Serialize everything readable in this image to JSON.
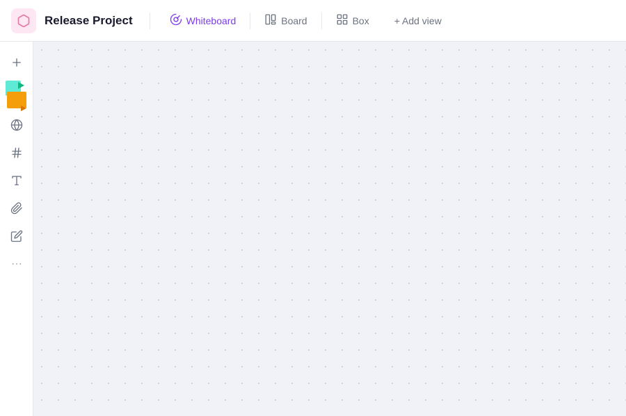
{
  "header": {
    "project_icon_alt": "release-project-icon",
    "project_title": "Release Project",
    "tabs": [
      {
        "id": "whiteboard",
        "label": "Whiteboard",
        "active": true,
        "icon": "whiteboard"
      },
      {
        "id": "board",
        "label": "Board",
        "active": false,
        "icon": "board"
      },
      {
        "id": "box",
        "label": "Box",
        "active": false,
        "icon": "box"
      }
    ],
    "add_view_label": "+ Add view"
  },
  "sidebar": {
    "tools": [
      {
        "id": "add",
        "icon": "plus",
        "label": "Add"
      },
      {
        "id": "sticky",
        "icon": "sticky-notes",
        "label": "Sticky Notes"
      },
      {
        "id": "globe",
        "icon": "globe",
        "label": "Globe"
      },
      {
        "id": "hashtag",
        "icon": "hashtag",
        "label": "Hashtag"
      },
      {
        "id": "text",
        "icon": "text",
        "label": "Text"
      },
      {
        "id": "attachment",
        "icon": "attachment",
        "label": "Attachment"
      },
      {
        "id": "draw",
        "icon": "draw",
        "label": "Draw"
      },
      {
        "id": "more",
        "icon": "ellipsis",
        "label": "More"
      }
    ]
  },
  "canvas": {
    "background": "#f0f2f7"
  }
}
